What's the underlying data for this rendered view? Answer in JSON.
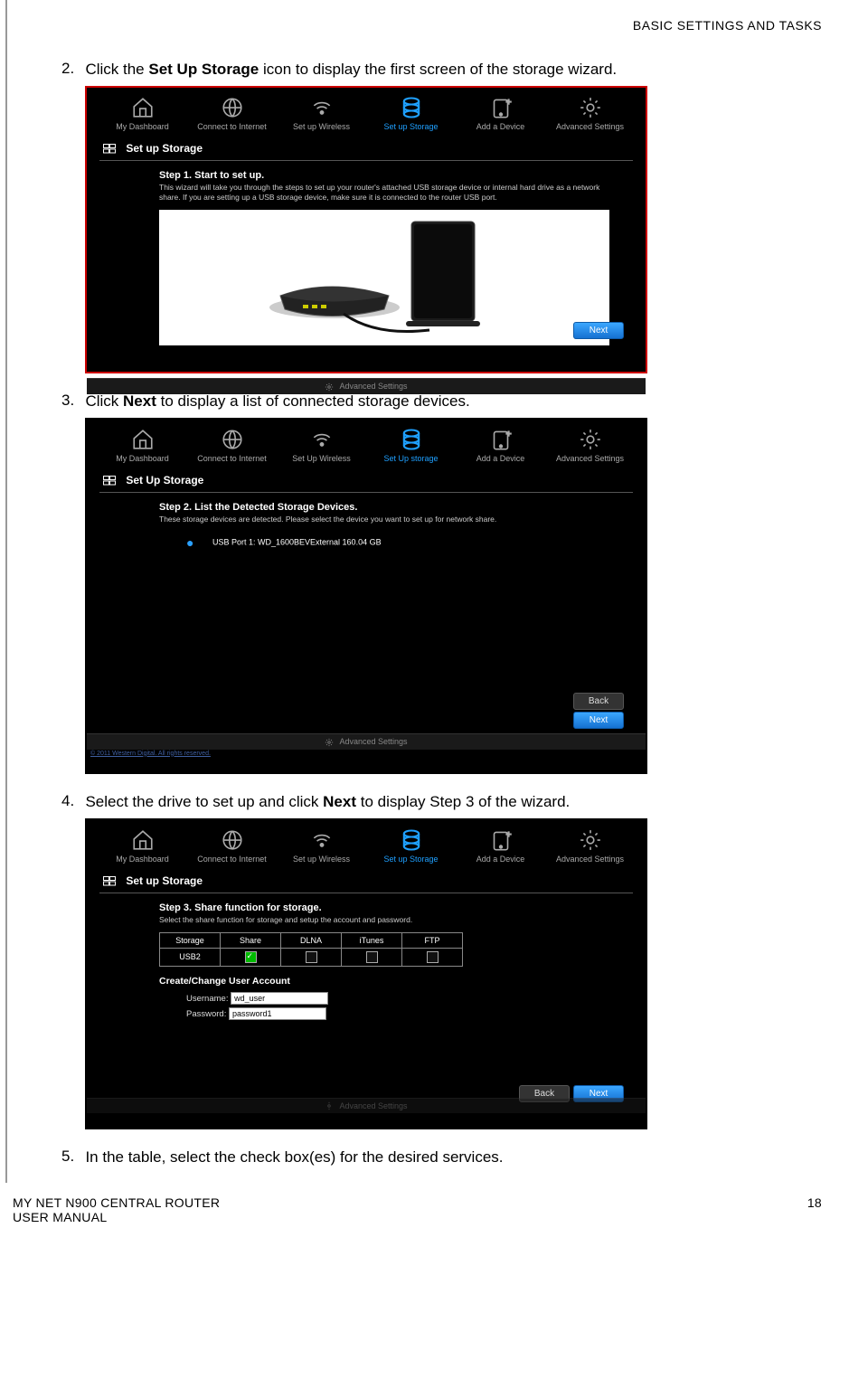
{
  "header": {
    "section": "BASIC SETTINGS AND TASKS"
  },
  "steps": {
    "s2": {
      "num": "2.",
      "pre": "Click the ",
      "bold": "Set Up Storage",
      "post": " icon to display the first screen of the storage wizard."
    },
    "s3": {
      "num": "3.",
      "pre": "Click ",
      "bold": "Next",
      "post": " to display a list of connected storage devices."
    },
    "s4": {
      "num": "4.",
      "pre": "Select the drive to set up and click ",
      "bold": "Next",
      "post": " to display Step 3 of the wizard."
    },
    "s5": {
      "num": "5.",
      "text": "In the table, select the check box(es) for the desired services."
    }
  },
  "nav": {
    "dashboard": "My Dashboard",
    "connect": "Connect to Internet",
    "wireless": "Set up Wireless",
    "wireless2": "Set Up Wireless",
    "storage": "Set up Storage",
    "storage2": "Set Up storage",
    "adddev": "Add a Device",
    "advanced": "Advanced Settings"
  },
  "panel1": {
    "title": "Set up Storage",
    "stepTitle": "Step 1. Start to set up.",
    "stepDesc": "This wizard will take you through the steps to set up your router's attached USB storage device or internal hard drive as a network share. If you are setting up a USB storage device, make sure it is connected to the router USB port.",
    "next": "Next",
    "advFooter": "Advanced Settings"
  },
  "panel2": {
    "title": "Set Up Storage",
    "stepTitle": "Step 2. List the Detected Storage Devices.",
    "stepDesc": "These storage devices are detected. Please select the device you want to set up for network share.",
    "device": "USB Port 1: WD_1600BEVExternal  160.04 GB",
    "back": "Back",
    "next": "Next",
    "advFooter": "Advanced Settings",
    "copyright": "© 2011 Western Digital. All rights reserved."
  },
  "panel3": {
    "title": "Set up Storage",
    "stepTitle": "Step 3. Share function for storage.",
    "stepDesc": "Select the share function for storage and setup the account and password.",
    "cols": {
      "storage": "Storage",
      "share": "Share",
      "dlna": "DLNA",
      "itunes": "iTunes",
      "ftp": "FTP"
    },
    "row": {
      "name": "USB2",
      "share": true,
      "dlna": false,
      "itunes": false,
      "ftp": false
    },
    "subhead": "Create/Change User Account",
    "userLabel": "Username:",
    "passLabel": "Password:",
    "userVal": "wd_user",
    "passVal": "password1",
    "back": "Back",
    "next": "Next",
    "advFooter": "Advanced Settings"
  },
  "footer": {
    "line1": "MY NET N900 CENTRAL ROUTER",
    "line2": "USER MANUAL",
    "page": "18"
  }
}
